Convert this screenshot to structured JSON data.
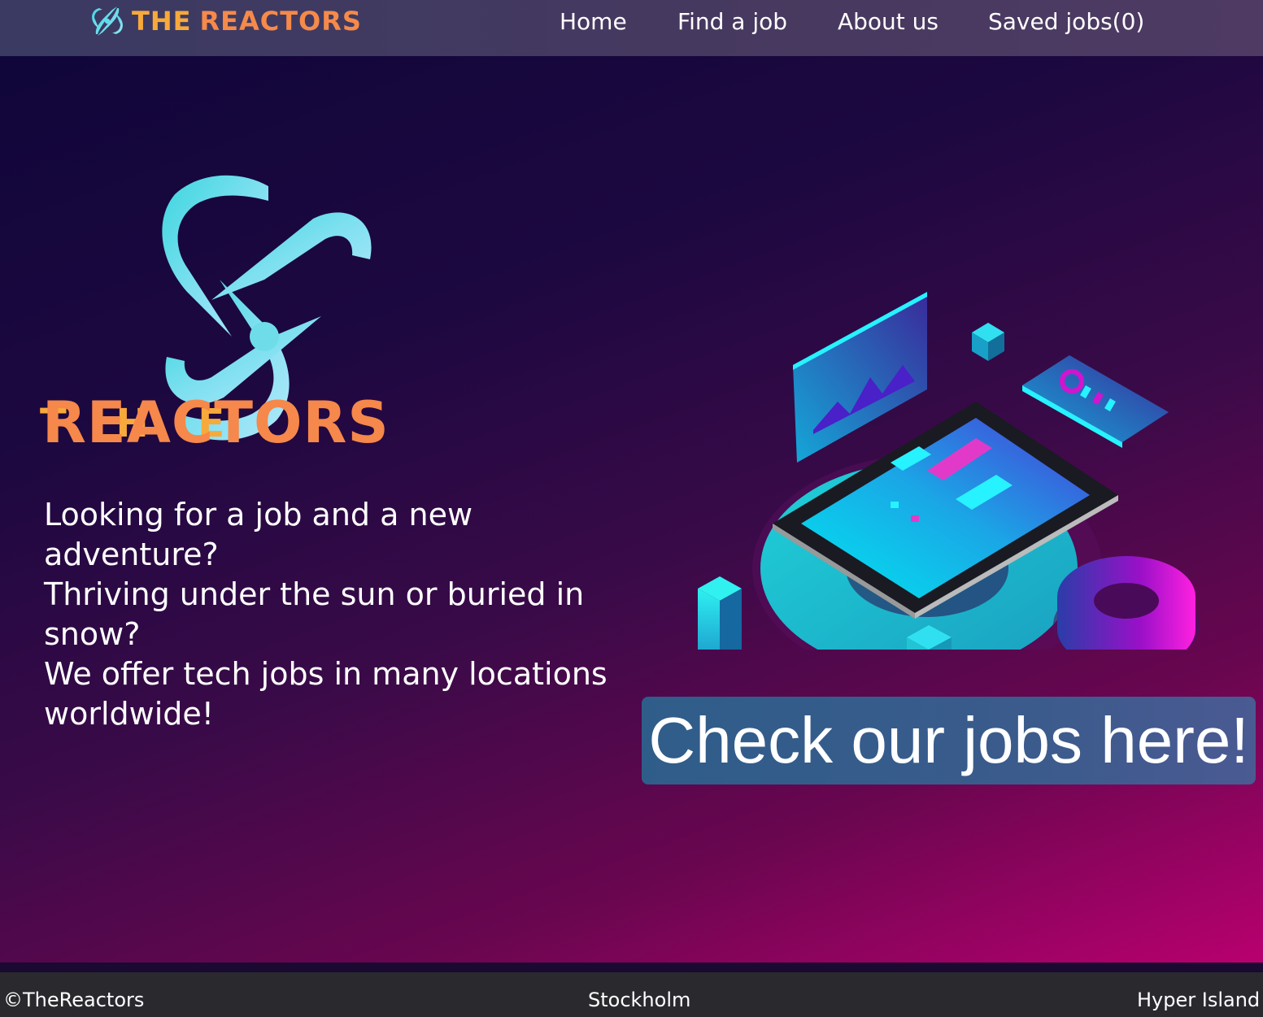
{
  "brand": {
    "the": "THE",
    "reactors": "REACTORS",
    "logo_icon": "atom-orbit-icon"
  },
  "nav": {
    "items": [
      {
        "label": "Home"
      },
      {
        "label": "Find a job"
      },
      {
        "label": "About us"
      },
      {
        "label": "Saved jobs(0)"
      }
    ]
  },
  "hero": {
    "logo": {
      "the": "T H E",
      "reactors": "REACTORS"
    },
    "tagline": [
      "Looking for a job and a new adventure?",
      "Thriving under the sun or buried in snow?",
      "We offer tech jobs in many locations worldwide!"
    ],
    "cta_label": "Check our jobs here!",
    "illustration_icon": "isometric-tablet-dashboard-illustration"
  },
  "footer": {
    "copyright": "©TheReactors",
    "city": "Stockholm",
    "partner": "Hyper Island"
  },
  "colors": {
    "brand_orange": "#f58a4a",
    "brand_yellow": "#f7a93a",
    "brand_cyan": "#4fd6e6",
    "cta_blue": "#3a5b8c"
  }
}
